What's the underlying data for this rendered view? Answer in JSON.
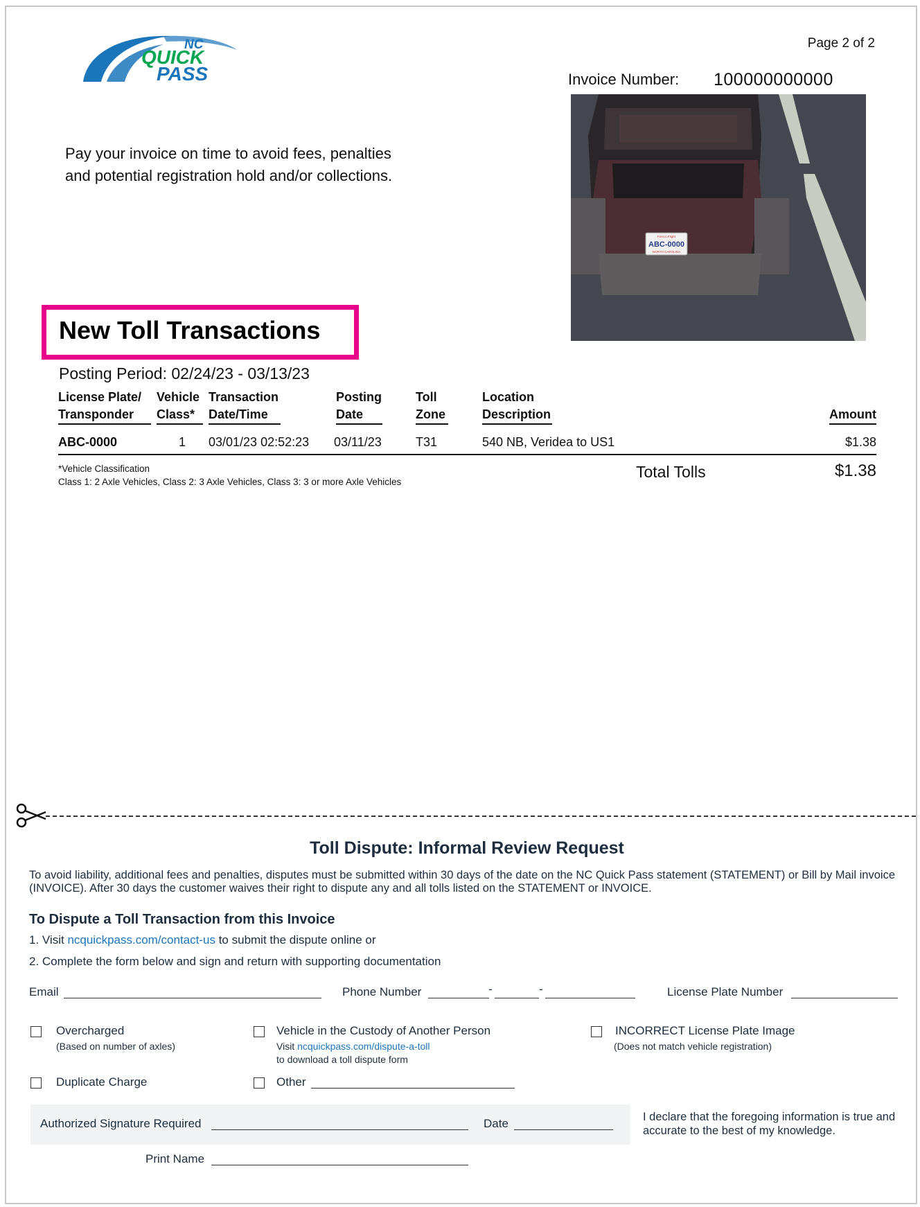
{
  "header": {
    "logo_small": "NC",
    "logo_line1": "QUICK",
    "logo_line2": "PASS",
    "page": "Page 2 of 2",
    "invoice_label": "Invoice Number:",
    "invoice_number": "100000000000"
  },
  "photo": {
    "plate_state_top": "First in Flight",
    "plate_text": "ABC-0000",
    "plate_state_bottom": "NORTH CAROLINA"
  },
  "pay_note": [
    "Pay your invoice on time to avoid fees, penalties",
    "and potential registration hold and/or collections."
  ],
  "section": {
    "title": "New Toll Transactions",
    "posting_period": "Posting Period: 02/24/23 - 03/13/23"
  },
  "table": {
    "headers": {
      "plate_1": "License Plate/",
      "plate_2": "Transponder",
      "class_1": "Vehicle",
      "class_2": "Class*",
      "txn_1": "Transaction",
      "txn_2": "Date/Time",
      "post_1": "Posting",
      "post_2": "Date",
      "zone_1": "Toll",
      "zone_2": "Zone",
      "loc_1": "Location",
      "loc_2": "Description",
      "amount": "Amount"
    },
    "rows": [
      {
        "plate": "ABC-0000",
        "class": "1",
        "txn_datetime": "03/01/23 02:52:23",
        "posting_date": "03/11/23",
        "zone": "T31",
        "location": "540 NB, Veridea to US1",
        "amount": "$1.38"
      }
    ],
    "class_note_1": "*Vehicle Classification",
    "class_note_2": "Class 1: 2 Axle Vehicles,  Class 2: 3 Axle Vehicles,  Class 3: 3 or more Axle Vehicles",
    "total_label": "Total Tolls",
    "total_value": "$1.38"
  },
  "dispute": {
    "title": "Toll Dispute: Informal Review Request",
    "intro": "To avoid liability, additional fees and penalties, disputes must be submitted within 30 days of the date on the NC Quick Pass statement (STATEMENT) or Bill by Mail invoice (INVOICE). After 30 days the customer waives their right to dispute any and all tolls listed on the STATEMENT or INVOICE.",
    "subtitle": "To Dispute a Toll Transaction from this Invoice",
    "step1_prefix": "1.  Visit ",
    "step1_link": "ncquickpass.com/contact-us",
    "step1_suffix": " to submit the dispute online or",
    "step2": "2. Complete the form below and sign and return with supporting documentation",
    "email_label": "Email",
    "phone_label": "Phone Number",
    "plate_label": "License Plate Number",
    "options": {
      "overcharged": "Overcharged",
      "overcharged_sub": "(Based on number of axles)",
      "custody": "Vehicle in the Custody of Another Person",
      "custody_sub1_prefix": "Visit ",
      "custody_sub1_link": "ncquickpass.com/dispute-a-toll",
      "custody_sub2": "to download a toll dispute form",
      "incorrect": "INCORRECT License Plate Image",
      "incorrect_sub": "(Does not match vehicle registration)",
      "duplicate": "Duplicate Charge",
      "other": "Other"
    },
    "signature_label": "Authorized Signature Required",
    "date_label": "Date",
    "print_name_label": "Print Name",
    "declaration": "I declare that the foregoing information is true and accurate to the best of my knowledge."
  },
  "colors": {
    "highlight": "#e8008a",
    "logo_blue": "#1b75bb",
    "logo_green": "#00a651",
    "link": "#1b75bb",
    "text_dark": "#1d2d3d"
  }
}
